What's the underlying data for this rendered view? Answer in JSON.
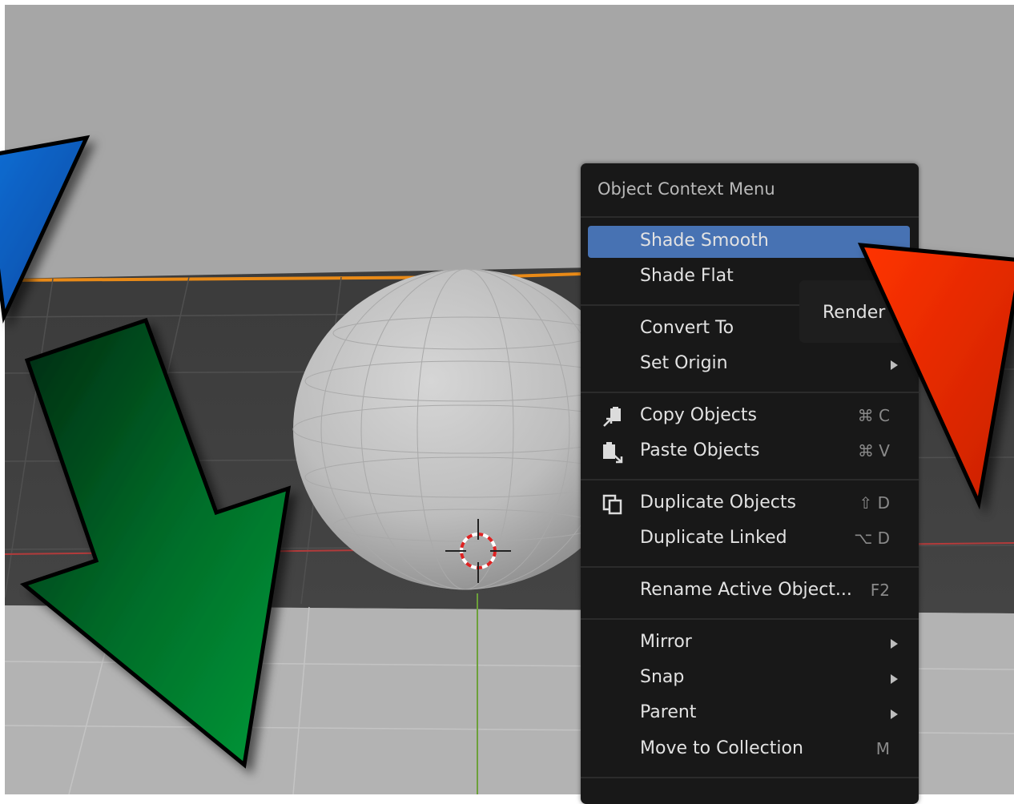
{
  "menu": {
    "title": "Object Context Menu",
    "items": [
      {
        "label": "Shade Smooth",
        "shortcut": "",
        "submenu": false,
        "active": true
      },
      {
        "label": "Shade Flat",
        "shortcut": "",
        "submenu": false,
        "active": false
      },
      {
        "label": "Convert To",
        "shortcut": "",
        "submenu": false,
        "active": false
      },
      {
        "label": "Set Origin",
        "shortcut": "",
        "submenu": true,
        "active": false
      },
      {
        "label": "Copy Objects",
        "shortcut": "⌘ C",
        "icon": "copy-objects-icon"
      },
      {
        "label": "Paste Objects",
        "shortcut": "⌘ V",
        "icon": "paste-objects-icon"
      },
      {
        "label": "Duplicate Objects",
        "shortcut": "⇧ D",
        "icon": "duplicate-objects-icon"
      },
      {
        "label": "Duplicate Linked",
        "shortcut": "⌥ D"
      },
      {
        "label": "Rename Active Object...",
        "shortcut": "F2"
      },
      {
        "label": "Mirror",
        "submenu": true
      },
      {
        "label": "Snap",
        "submenu": true
      },
      {
        "label": "Parent",
        "submenu": true
      },
      {
        "label": "Move to Collection",
        "shortcut": "M"
      }
    ]
  },
  "submenu_peek": {
    "label": "Render"
  },
  "colors": {
    "viewport_bg": "#a6a6a6",
    "menu_bg": "#181818",
    "highlight": "#4772b3",
    "arrow_blue": "#0a5fc0",
    "arrow_green": "#007a2e",
    "arrow_red": "#e12200"
  }
}
